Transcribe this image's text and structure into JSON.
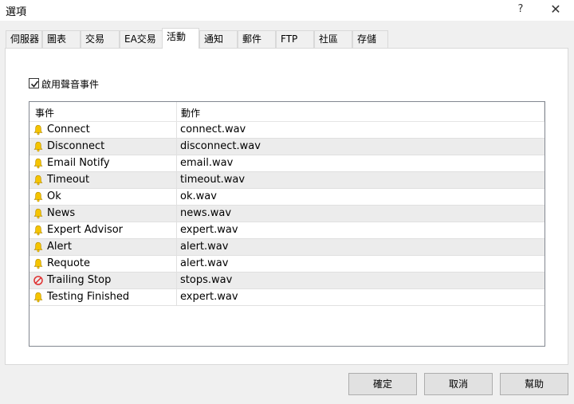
{
  "window": {
    "title": "選項",
    "help_label": "?",
    "close_label": "✕"
  },
  "tabs": [
    {
      "label": "伺服器"
    },
    {
      "label": "圖表"
    },
    {
      "label": "交易"
    },
    {
      "label": "EA交易"
    },
    {
      "label": "活動"
    },
    {
      "label": "通知"
    },
    {
      "label": "郵件"
    },
    {
      "label": "FTP"
    },
    {
      "label": "社區"
    },
    {
      "label": "存儲"
    }
  ],
  "active_tab": "活動",
  "events_panel": {
    "enable_sounds_label": "啟用聲音事件",
    "enable_sounds_checked": true,
    "columns": {
      "event": "事件",
      "action": "動作"
    },
    "rows": [
      {
        "event": "Connect",
        "action": "connect.wav",
        "icon": "bell-icon"
      },
      {
        "event": "Disconnect",
        "action": "disconnect.wav",
        "icon": "bell-icon"
      },
      {
        "event": "Email Notify",
        "action": "email.wav",
        "icon": "bell-icon"
      },
      {
        "event": "Timeout",
        "action": "timeout.wav",
        "icon": "bell-icon"
      },
      {
        "event": "Ok",
        "action": "ok.wav",
        "icon": "bell-icon"
      },
      {
        "event": "News",
        "action": "news.wav",
        "icon": "bell-icon"
      },
      {
        "event": "Expert Advisor",
        "action": "expert.wav",
        "icon": "bell-icon"
      },
      {
        "event": "Alert",
        "action": "alert.wav",
        "icon": "bell-icon"
      },
      {
        "event": "Requote",
        "action": "alert.wav",
        "icon": "bell-icon"
      },
      {
        "event": "Trailing Stop",
        "action": "stops.wav",
        "icon": "disabled-icon"
      },
      {
        "event": "Testing Finished",
        "action": "expert.wav",
        "icon": "bell-icon"
      }
    ]
  },
  "buttons": {
    "ok": "確定",
    "cancel": "取消",
    "help": "幫助"
  },
  "colors": {
    "bell": "#f5c400",
    "disabled": "#e03030",
    "alt_row": "#ececec"
  }
}
